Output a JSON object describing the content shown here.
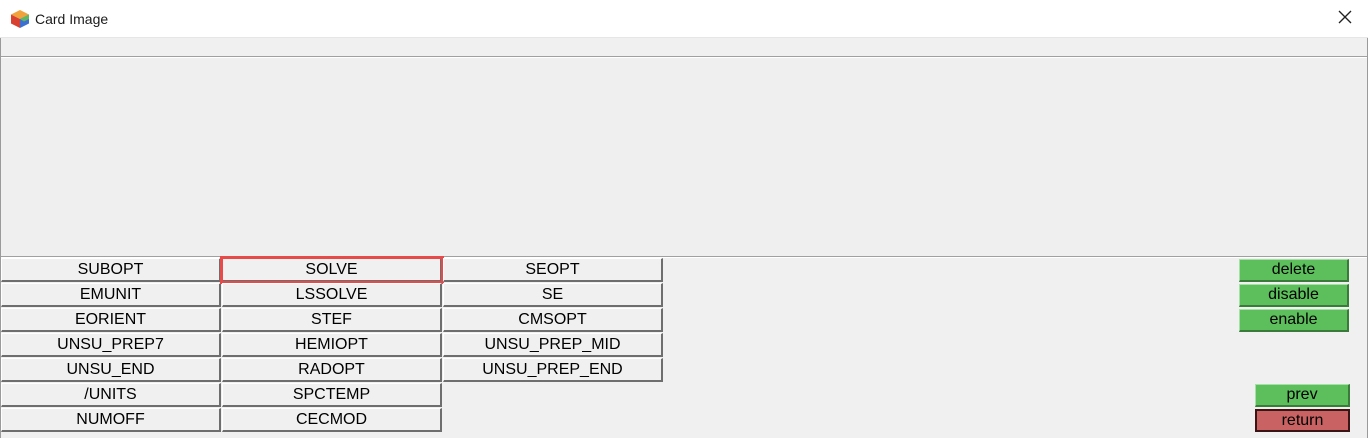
{
  "window": {
    "title": "Card Image",
    "icon": "cube-app-icon",
    "close_icon": "close-icon"
  },
  "grid": {
    "col1": [
      "SUBOPT",
      "EMUNIT",
      "EORIENT",
      "UNSU_PREP7",
      "UNSU_END",
      "/UNITS",
      "NUMOFF"
    ],
    "col2": [
      "SOLVE",
      "LSSOLVE",
      "STEF",
      "HEMIOPT",
      "RADOPT",
      "SPCTEMP",
      "CECMOD"
    ],
    "col3": [
      "SEOPT",
      "SE",
      "CMSOPT",
      "UNSU_PREP_MID",
      "UNSU_PREP_END"
    ],
    "selected": "SOLVE"
  },
  "actions": {
    "delete": "delete",
    "disable": "disable",
    "enable": "enable",
    "prev": "prev",
    "return": "return"
  },
  "colors": {
    "green": "#5cbf5c",
    "red": "#c96262",
    "highlight": "#e84a4a"
  }
}
